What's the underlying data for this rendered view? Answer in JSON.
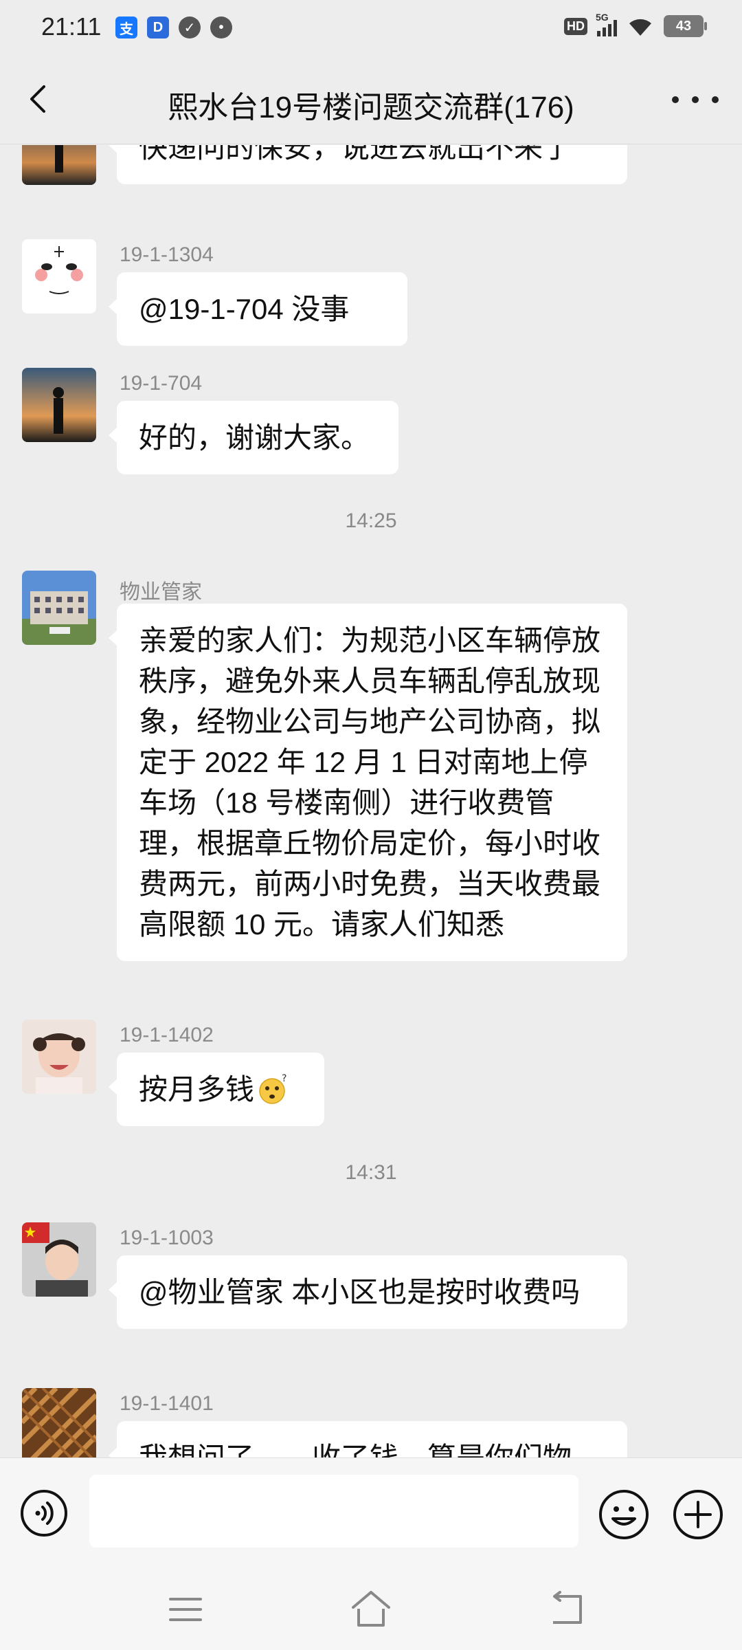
{
  "status_bar": {
    "time": "21:11",
    "hd_label": "HD",
    "network_label": "5G",
    "battery_level": "43"
  },
  "header": {
    "title": "熙水台19号楼问题交流群(176)"
  },
  "messages": [
    {
      "sender": "",
      "text": "快递问的保安，说进去就出不来了"
    },
    {
      "sender": "19-1-1304",
      "text": "@19-1-704  没事"
    },
    {
      "sender": "19-1-704",
      "text": "好的，谢谢大家。"
    },
    {
      "sender": "物业管家",
      "text": "亲爱的家人们：为规范小区车辆停放秩序，避免外来人员车辆乱停乱放现象，经物业公司与地产公司协商，拟定于 2022 年 12 月 1 日对南地上停车场（18 号楼南侧）进行收费管理，根据章丘物价局定价，每小时收费两元，前两小时免费，当天收费最高限额 10 元。请家人们知悉"
    },
    {
      "sender": "19-1-1402",
      "text": "按月多钱"
    },
    {
      "sender": "19-1-1003",
      "text": "@物业管家  本小区也是按时收费吗"
    },
    {
      "sender": "19-1-1401",
      "text": "我想问了……收了钱，算是你们物"
    }
  ],
  "time_dividers": [
    "14:25",
    "14:31"
  ],
  "input": {
    "placeholder": ""
  },
  "colors": {
    "background": "#ededed",
    "bubble": "#ffffff",
    "meta_text": "#8a8a8a"
  }
}
